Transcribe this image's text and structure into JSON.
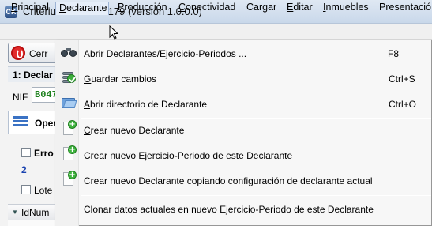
{
  "window": {
    "title": "Criterium - Genera179 (versión 1.0.0.0)",
    "app_icon_text": "CK"
  },
  "menubar": {
    "items": [
      {
        "label": "Principal",
        "accel": "P",
        "rest": "rincipal"
      },
      {
        "label": "Declarante",
        "accel": "D",
        "rest": "eclarante"
      },
      {
        "label": "Producción",
        "accel": "P",
        "rest": "roducción"
      },
      {
        "label": "Conectividad",
        "accel": "C",
        "rest": "onectividad"
      },
      {
        "label": "Cargar",
        "accel": "",
        "rest": "Cargar"
      },
      {
        "label": "Editar",
        "accel": "E",
        "rest": "ditar"
      },
      {
        "label": "Inmuebles",
        "accel": "I",
        "rest": "nmuebles"
      },
      {
        "label": "Presentación",
        "accel": "",
        "rest": "Presentació"
      }
    ]
  },
  "background": {
    "close_button": "Cerr",
    "panel_title": "1: Declar",
    "nif_label": "NIF",
    "nif_value": "B047",
    "operations_tab": "Oper",
    "errors_label": "Erro",
    "errors_count": "2",
    "lote_label": "Lote",
    "grid_column": "IdNum"
  },
  "dropdown": {
    "items": [
      {
        "label": "Abrir Declarantes/Ejercicio-Periodos ...",
        "shortcut": "F8",
        "icon": "binoculars-icon"
      },
      {
        "label": "Guardar cambios",
        "shortcut": "Ctrl+S",
        "icon": "save-check-icon"
      },
      {
        "label": "Abrir directorio de Declarante",
        "shortcut": "Ctrl+O",
        "icon": "folder-icon"
      },
      {
        "label": "Crear nuevo Declarante",
        "shortcut": "",
        "icon": "new-document-icon"
      },
      {
        "label": "Crear nuevo Ejercicio-Periodo de este Declarante",
        "shortcut": "",
        "icon": "new-document-icon"
      },
      {
        "label": "Crear nuevo Declarante copiando configuración de declarante actual",
        "shortcut": "",
        "icon": "new-document-icon"
      },
      {
        "label": "Clonar datos actuales en nuevo Ejercicio-Periodo de este Declarante",
        "shortcut": "",
        "icon": ""
      }
    ]
  },
  "colors": {
    "menu_highlight": "#e6eef9",
    "nif_text": "#1a7f1a",
    "count_text": "#1a43b0",
    "close_red": "#e22b2b"
  }
}
